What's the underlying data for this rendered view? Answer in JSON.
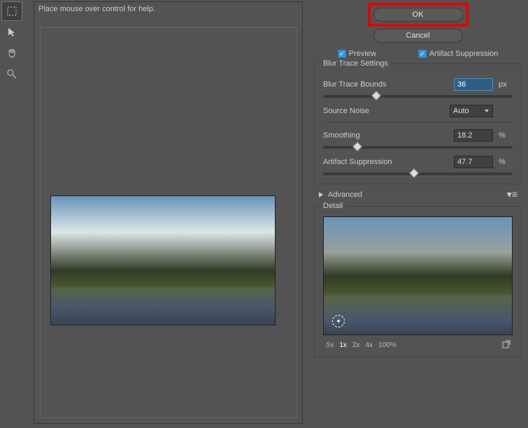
{
  "help_bar": "Place mouse over control for help.",
  "actions": {
    "ok": "OK",
    "cancel": "Cancel"
  },
  "checkboxes": {
    "preview": "Preview",
    "artifact_suppression": "Artifact Suppression"
  },
  "blur_trace": {
    "title": "Blur Trace Settings",
    "bounds_label": "Blur Trace Bounds",
    "bounds_value": "36",
    "bounds_unit": "px",
    "source_noise_label": "Source Noise",
    "source_noise_value": "Auto",
    "smoothing_label": "Smoothing",
    "smoothing_value": "18.2",
    "smoothing_unit": "%",
    "artifact_label": "Artifact Suppression",
    "artifact_value": "47.7",
    "artifact_unit": "%"
  },
  "advanced": {
    "label": "Advanced"
  },
  "detail": {
    "title": "Detail",
    "zoom": {
      "levels": [
        ".5x",
        "1x",
        "2x",
        "4x"
      ],
      "current": "100%"
    }
  }
}
